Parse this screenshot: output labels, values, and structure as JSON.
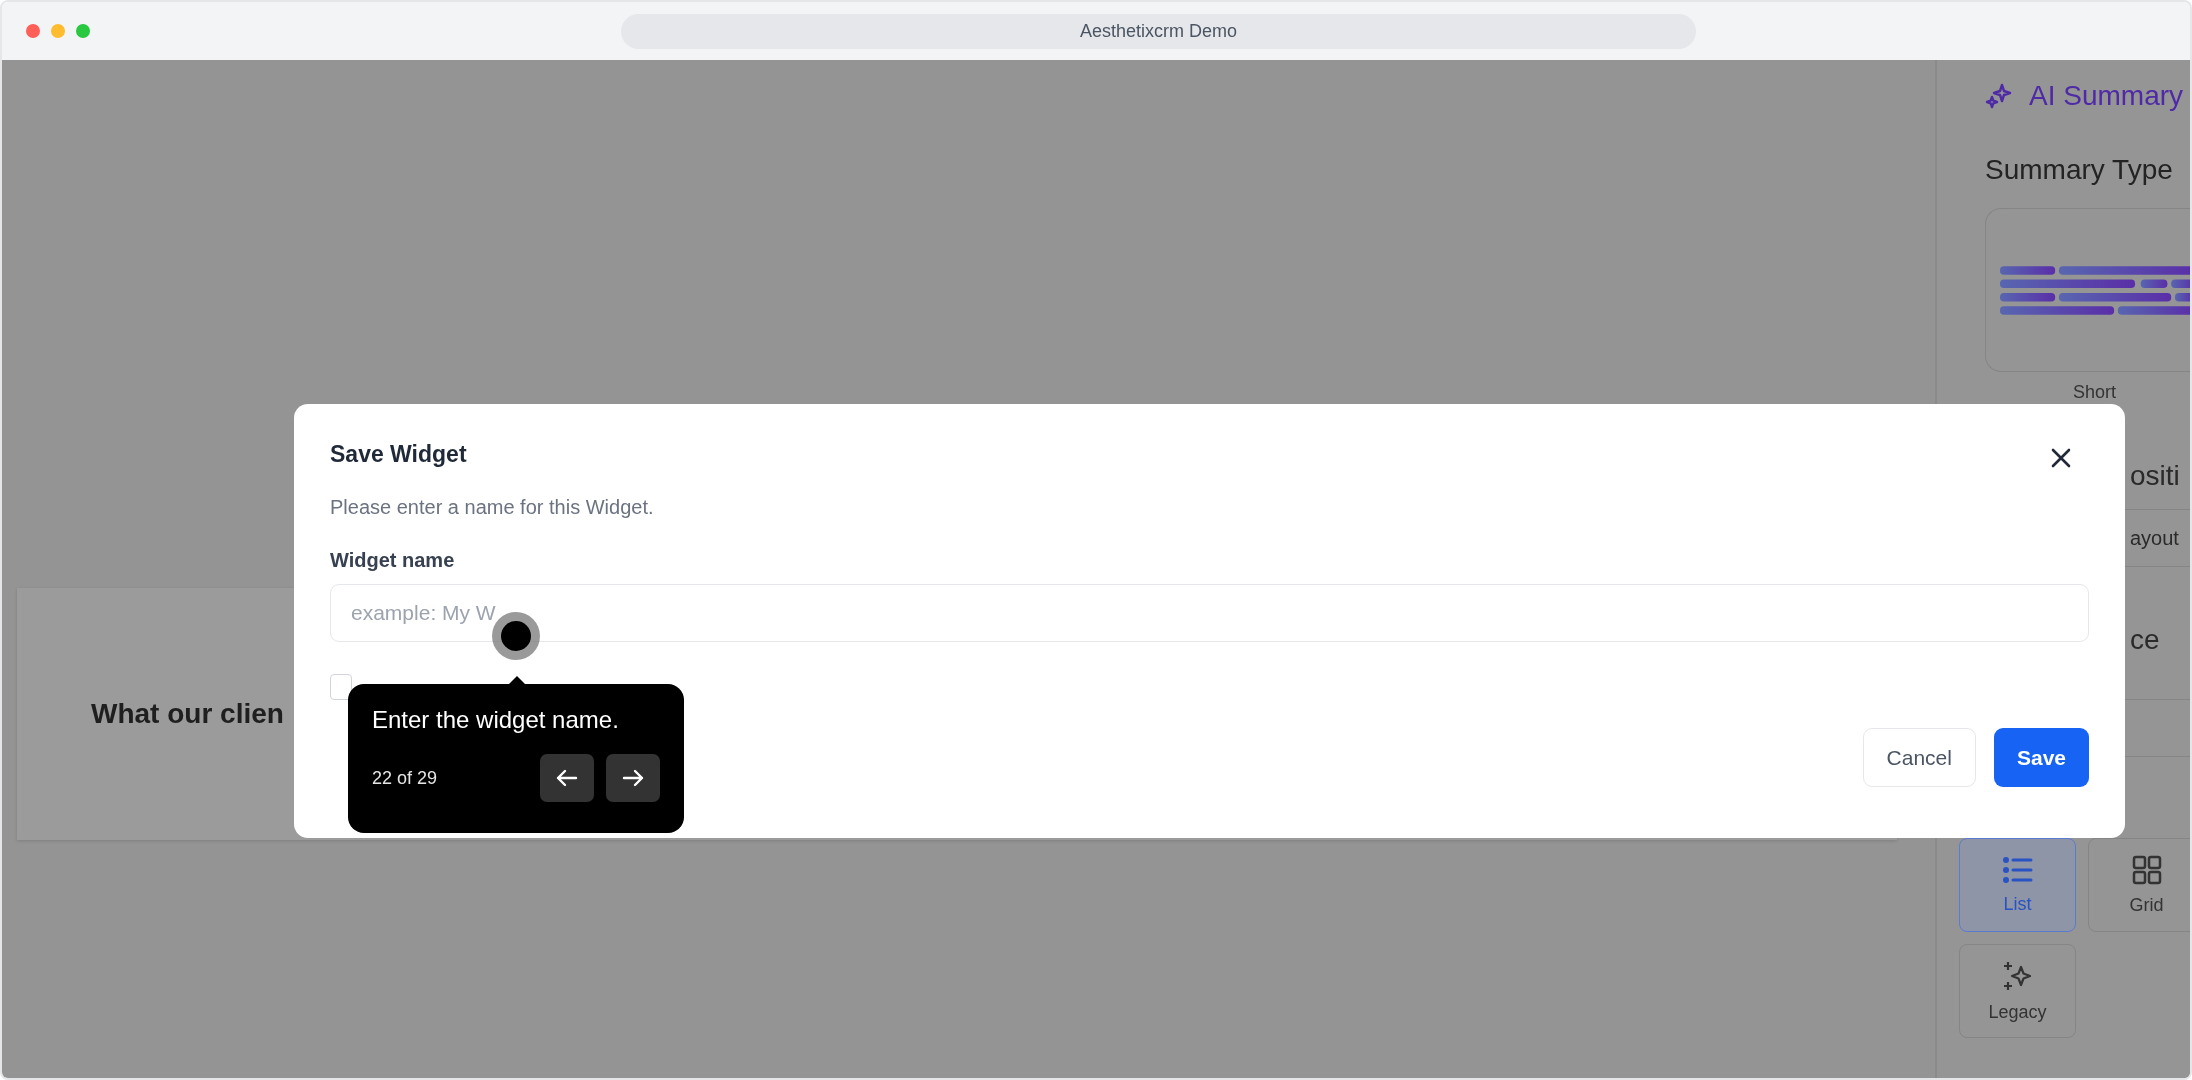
{
  "browser": {
    "url": "Aesthetixcrm Demo"
  },
  "page": {
    "card_heading": "What our clien"
  },
  "side_panel": {
    "title": "AI Summary",
    "summary_type_heading": "Summary Type",
    "summary_type_option": "Short",
    "fragments": [
      {
        "kind": "heading",
        "text": "ositi"
      },
      {
        "kind": "box",
        "text": "ayout"
      },
      {
        "kind": "heading",
        "text": "ce"
      }
    ],
    "layout_options": [
      {
        "kind": "list",
        "label": "List",
        "selected": true
      },
      {
        "kind": "grid",
        "label": "Grid",
        "selected": false
      },
      {
        "kind": "legacy",
        "label": "Legacy",
        "selected": false
      }
    ]
  },
  "dialog": {
    "title": "Save Widget",
    "description": "Please enter a name for this Widget.",
    "field": {
      "label": "Widget name",
      "placeholder": "example: My W"
    },
    "checkbox": {
      "checked": false
    },
    "buttons": [
      {
        "kind": "secondary",
        "label": "Cancel"
      },
      {
        "kind": "primary",
        "label": "Save"
      }
    ]
  },
  "tour_tooltip": {
    "text": "Enter the widget name.",
    "progress": "22 of 29"
  }
}
